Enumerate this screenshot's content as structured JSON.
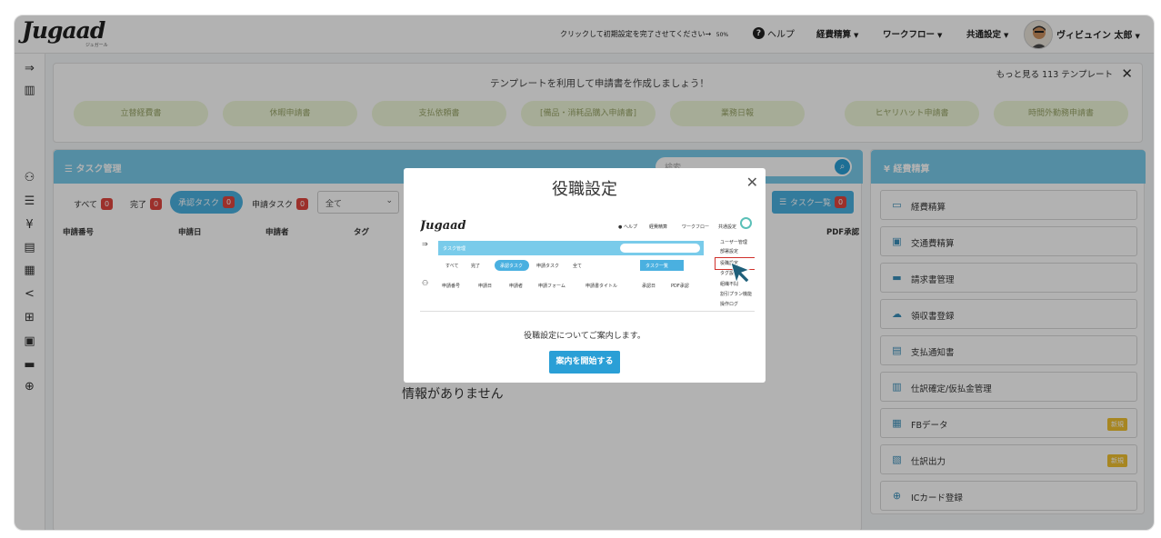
{
  "header": {
    "logo": "Jugaad",
    "logo_sub": "ジュガール",
    "setup_prompt": "クリックして初期設定を完了させてください→",
    "setup_progress": "50%",
    "help": "ヘルプ",
    "nav": [
      "経費精算",
      "ワークフロー",
      "共通設定"
    ],
    "user_name": "ヴィビュイン 太郎"
  },
  "template_banner": {
    "title": "テンプレートを利用して申請書を作成しましょう！",
    "more": "もっと見る 113 テンプレート",
    "chips": [
      "立替経費書",
      "休暇申請書",
      "支払依頼書",
      "[備品・消耗品購入申請書]",
      "業務日報",
      "ヒヤリハット申請書",
      "時間外勤務申請書"
    ]
  },
  "task_panel": {
    "title": "タスク管理",
    "search_placeholder": "検索",
    "filters": [
      {
        "label": "すべて",
        "count": "0"
      },
      {
        "label": "完了",
        "count": "0"
      },
      {
        "label": "承認タスク",
        "count": "0"
      },
      {
        "label": "申請タスク",
        "count": "0"
      }
    ],
    "select_value": "全て",
    "task_list_button": "タスク一覧",
    "task_list_count": "0",
    "columns": [
      "申請番号",
      "申請日",
      "申請者",
      "タグ",
      "PDF承認"
    ],
    "empty_message": "情報がありません"
  },
  "expense_panel": {
    "title": "経費精算",
    "items": [
      {
        "label": "経費精算",
        "icon": "receipt-icon",
        "new": ""
      },
      {
        "label": "交通費精算",
        "icon": "train-icon",
        "new": ""
      },
      {
        "label": "請求書管理",
        "icon": "invoice-icon",
        "new": ""
      },
      {
        "label": "領収書登録",
        "icon": "upload-icon",
        "new": ""
      },
      {
        "label": "支払通知書",
        "icon": "notice-icon",
        "new": ""
      },
      {
        "label": "仕訳確定/仮払金管理",
        "icon": "journal-icon",
        "new": ""
      },
      {
        "label": "FBデータ",
        "icon": "fb-data-icon",
        "new": "新規"
      },
      {
        "label": "仕訳出力",
        "icon": "export-icon",
        "new": "新規"
      },
      {
        "label": "ICカード登録",
        "icon": "ic-card-icon",
        "new": ""
      }
    ]
  },
  "modal": {
    "title": "役職設定",
    "description": "役職設定についてご案内します。",
    "start_button": "案内を開始する",
    "preview": {
      "logo": "Jugaad",
      "help": "ヘルプ",
      "nav": [
        "経費精算",
        "ワークフロー",
        "共通設定"
      ],
      "panel_title": "タスク管理",
      "filters": [
        "すべて",
        "完了",
        "承認タスク",
        "申請タスク"
      ],
      "select_value": "全て",
      "task_list_button": "タスク一覧",
      "columns": [
        "申請番号",
        "申請日",
        "申請者",
        "申請フォーム",
        "申請書タイトル",
        "承認日",
        "PDF承認"
      ],
      "menu": [
        "ユーザー管理",
        "部署設定",
        "役職設定",
        "タグ設定",
        "組織不問",
        "割引プラン機能",
        "操作ログ"
      ]
    }
  },
  "colors": {
    "accent": "#79cbea",
    "primary_button": "#2a9fd6",
    "badge": "#e0463e",
    "new_badge": "#f0c030"
  }
}
